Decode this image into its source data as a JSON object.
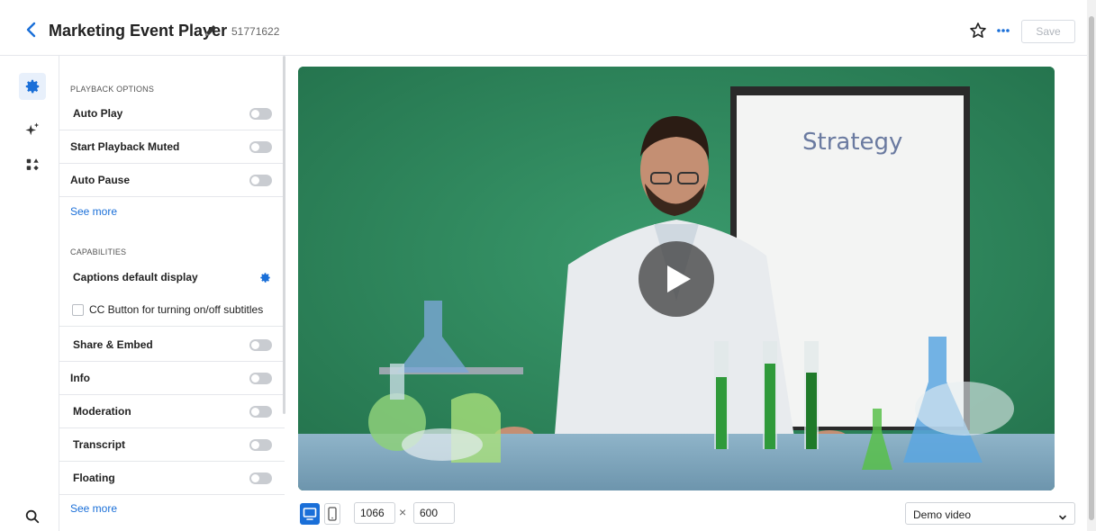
{
  "header": {
    "title": "Marketing Event Player",
    "player_id": "51771622",
    "save_label": "Save"
  },
  "rail": {
    "items": [
      "gear-icon",
      "sparkle-icon",
      "shapes-icon"
    ],
    "bottom": "search-icon"
  },
  "panel": {
    "playback_heading": "PLAYBACK OPTIONS",
    "playback_rows": [
      {
        "label": "Auto Play",
        "on": false
      },
      {
        "label": "Start Playback Muted",
        "on": false
      },
      {
        "label": "Auto Pause",
        "on": false
      }
    ],
    "see_more_1": "See more",
    "capabilities_heading": "CAPABILITIES",
    "captions_label": "Captions default display",
    "cc_label": "CC Button for turning on/off subtitles",
    "capability_rows": [
      {
        "label": "Share & Embed",
        "on": false
      },
      {
        "label": "Info",
        "on": false
      },
      {
        "label": "Moderation",
        "on": false
      },
      {
        "label": "Transcript",
        "on": false
      },
      {
        "label": "Floating",
        "on": false
      }
    ],
    "see_more_2": "See more"
  },
  "video": {
    "whiteboard_text": "Strategy"
  },
  "bottom_bar": {
    "width": "1066",
    "times": "×",
    "height": "600",
    "source_selected": "Demo video"
  },
  "colors": {
    "accent": "#1a6fd8",
    "video_bg": "#2f8a5f"
  }
}
